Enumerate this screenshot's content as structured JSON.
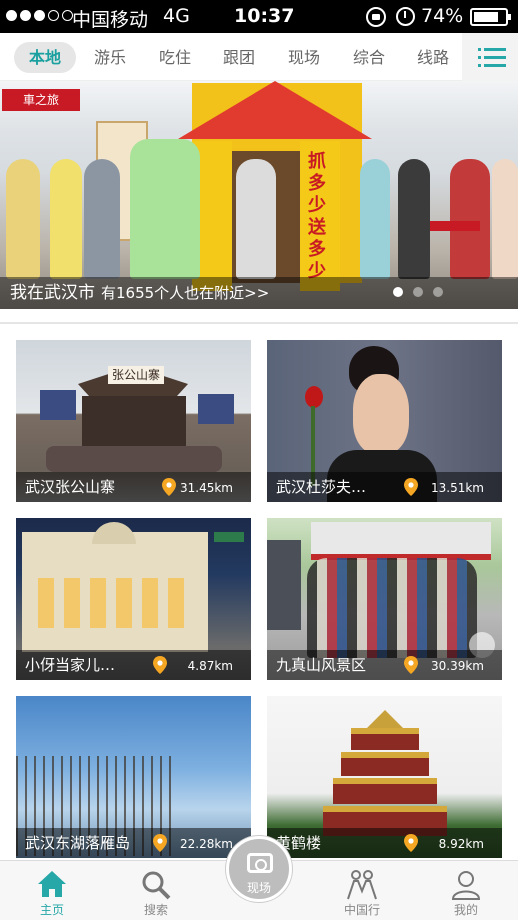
{
  "status_bar": {
    "carrier": "中国移动",
    "network": "4G",
    "time": "10:37",
    "battery": "74%"
  },
  "tabs": [
    {
      "label": "本地",
      "active": true
    },
    {
      "label": "游乐",
      "active": false
    },
    {
      "label": "吃住",
      "active": false
    },
    {
      "label": "跟团",
      "active": false
    },
    {
      "label": "现场",
      "active": false
    },
    {
      "label": "综合",
      "active": false
    },
    {
      "label": "线路",
      "active": false
    }
  ],
  "banner": {
    "location_text": "我在武汉市",
    "nearby_text": "有1655个人也在附近>>",
    "sign_left": "車之旅",
    "booth_text": "抓多少送多少",
    "page_count": 3,
    "active_page": 1
  },
  "places": [
    {
      "name": "武汉张公山寨",
      "distance": "31.45km",
      "gate_text": "张公山寨"
    },
    {
      "name": "武汉杜莎夫…",
      "distance": "13.51km"
    },
    {
      "name": "小伢当家儿…",
      "distance": "4.87km"
    },
    {
      "name": "九真山风景区",
      "distance": "30.39km"
    },
    {
      "name": "武汉东湖落雁岛",
      "distance": "22.28km"
    },
    {
      "name": "黄鹤楼",
      "distance": "8.92km"
    }
  ],
  "bottom_nav": {
    "home": "主页",
    "search": "搜索",
    "camera": "现场",
    "china_travel": "中国行",
    "mine": "我的"
  },
  "colors": {
    "accent": "#26a7a8",
    "pin": "#f5a623"
  }
}
